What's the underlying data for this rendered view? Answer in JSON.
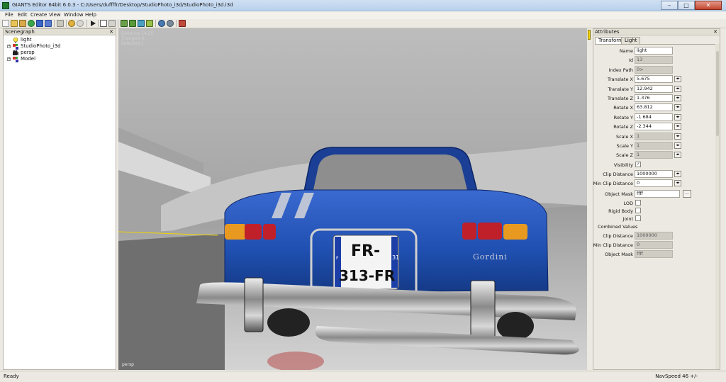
{
  "window": {
    "title": "GIANTS Editor 64bit 6.0.3 - C:/Users/duffffr/Desktop/StudioPhoto_i3d/StudioPhoto_i3d.i3d"
  },
  "menu": [
    "File",
    "Edit",
    "Create",
    "View",
    "Window",
    "Help"
  ],
  "scenegraph": {
    "title": "Scenegraph",
    "items": [
      {
        "label": "light",
        "icon": "bulb-icon",
        "expandable": false
      },
      {
        "label": "StudioPhoto_i3d",
        "icon": "transform-group-icon",
        "expandable": true
      },
      {
        "label": "persp",
        "icon": "camera-icon",
        "expandable": false
      },
      {
        "label": "Model",
        "icon": "transform-group-icon",
        "expandable": true
      }
    ]
  },
  "viewport": {
    "stats": [
      "Distance 14.25",
      "Triangles 0",
      "Selected 1"
    ],
    "camera_label": "persp",
    "plate": {
      "line1": "FR-",
      "line2": "313-FR",
      "region": "31",
      "country": "F"
    },
    "badge": "Gordini"
  },
  "attributes": {
    "title": "Attributes",
    "tabs": [
      "Transform",
      "Light"
    ],
    "rows": [
      {
        "label": "Name",
        "value": "light",
        "readonly": false,
        "spin": false
      },
      {
        "label": "Id",
        "value": "13",
        "readonly": true,
        "spin": false
      },
      {
        "label": "Index Path",
        "value": "0>",
        "readonly": true,
        "spin": false
      },
      {
        "label": "Translate X",
        "value": "5.675",
        "readonly": false,
        "spin": true
      },
      {
        "label": "Translate Y",
        "value": "12.942",
        "readonly": false,
        "spin": true
      },
      {
        "label": "Translate Z",
        "value": "1.376",
        "readonly": false,
        "spin": true
      },
      {
        "label": "Rotate X",
        "value": "63.812",
        "readonly": false,
        "spin": true
      },
      {
        "label": "Rotate Y",
        "value": "-1.684",
        "readonly": false,
        "spin": true
      },
      {
        "label": "Rotate Z",
        "value": "-2.344",
        "readonly": false,
        "spin": true
      },
      {
        "label": "Scale X",
        "value": "1",
        "readonly": true,
        "spin": true
      },
      {
        "label": "Scale Y",
        "value": "1",
        "readonly": true,
        "spin": true
      },
      {
        "label": "Scale Z",
        "value": "1",
        "readonly": true,
        "spin": true
      }
    ],
    "visibility": {
      "label": "Visibility",
      "checked": true
    },
    "clip_distance": {
      "label": "Clip Distance",
      "value": "1000000"
    },
    "min_clip_distance": {
      "label": "Min Clip Distance",
      "value": "0"
    },
    "object_mask": {
      "label": "Object Mask",
      "value": "ffff",
      "button": "..."
    },
    "lod": {
      "label": "LOD"
    },
    "rigid_body": {
      "label": "Rigid Body"
    },
    "joint": {
      "label": "Joint"
    },
    "combined": {
      "title": "Combined Values",
      "clip_distance": {
        "label": "Clip Distance",
        "value": "1000000"
      },
      "min_clip_distance": {
        "label": "Min Clip Distance",
        "value": "0"
      },
      "object_mask": {
        "label": "Object Mask",
        "value": "ffff"
      }
    }
  },
  "status": {
    "left": "Ready",
    "nav": "NavSpeed 46 +/-"
  },
  "colors": {
    "car_blue": "#1f4fb0",
    "accent_yellow": "#f2d500"
  }
}
